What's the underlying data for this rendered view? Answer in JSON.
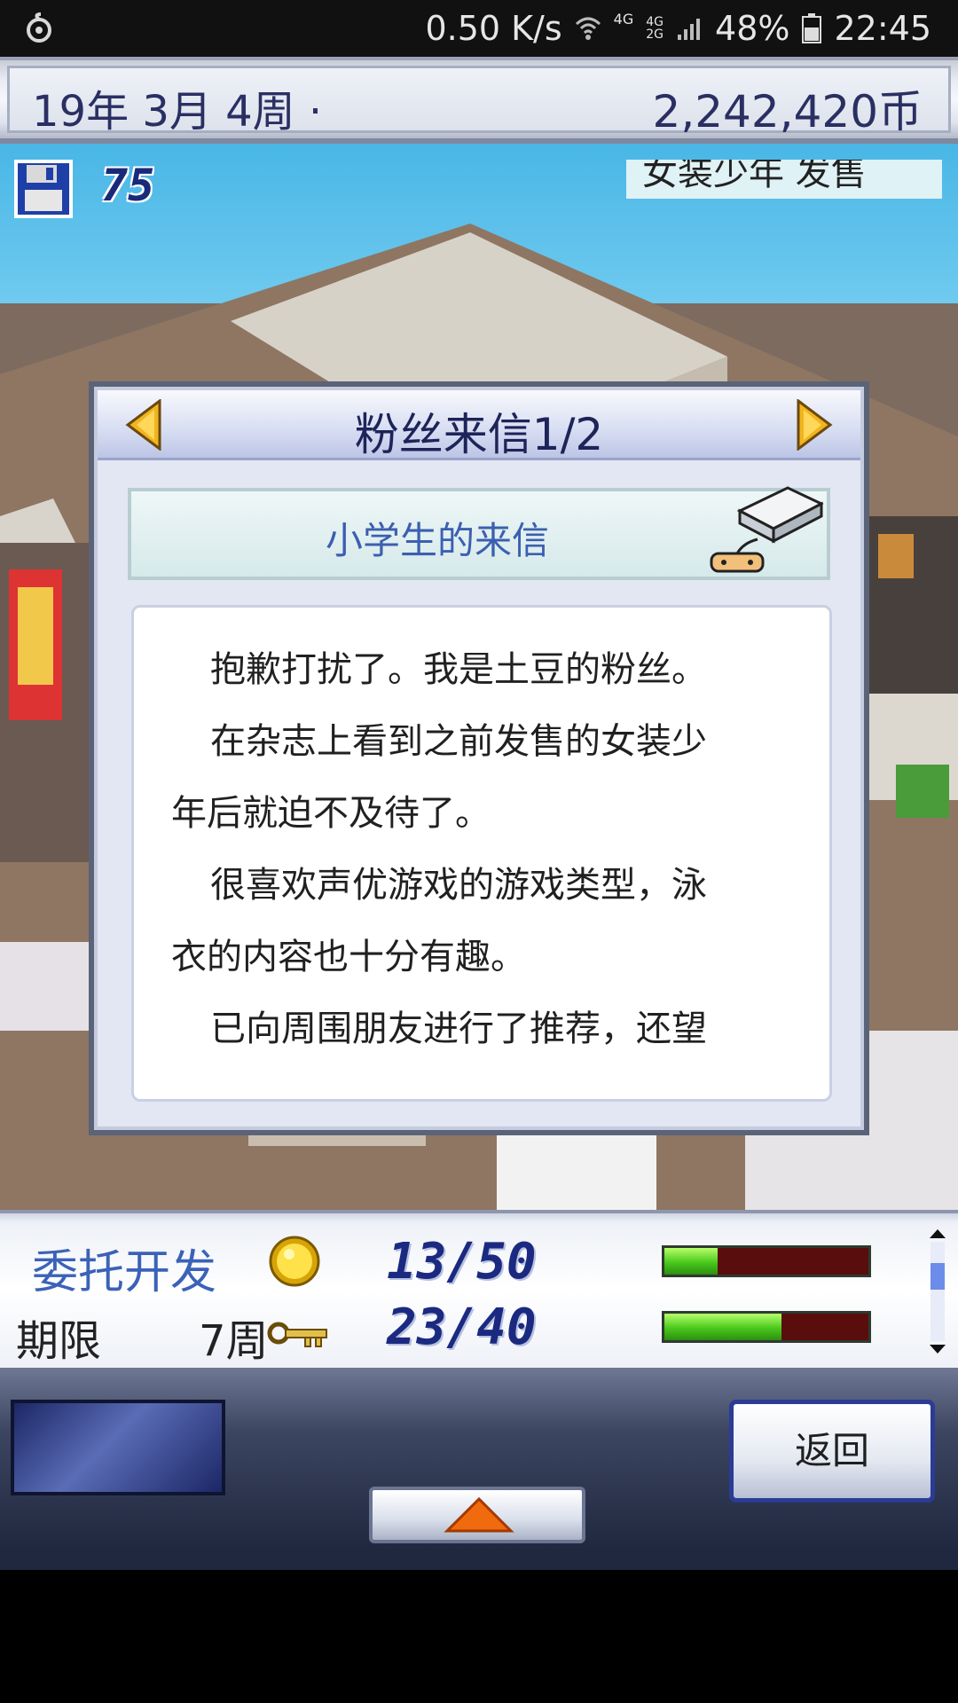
{
  "status_bar": {
    "net_speed": "0.50 K/s",
    "network_4g_top": "4G",
    "network_4g_mid": "4G",
    "network_2g": "2G",
    "battery": "48%",
    "time": "22:45"
  },
  "top_bar": {
    "date": "19年 3月 4周 ·",
    "money": "2,242,420币"
  },
  "scene": {
    "save_count": "75",
    "ticker_text": "女装少年 发售"
  },
  "dialog": {
    "title": "粉丝来信1/2",
    "sender": "小学生的来信",
    "paragraphs": [
      "抱歉打扰了。我是土豆的粉丝。",
      "在杂志上看到之前发售的女装少",
      "年后就迫不及待了。",
      "很喜欢声优游戏的游戏类型，泳",
      "衣的内容也十分有趣。",
      "已向周围朋友进行了推荐，还望"
    ]
  },
  "commission": {
    "label": "委托开发",
    "deadline_label": "期限",
    "deadline_value": "7周",
    "progress_1": "13/50",
    "progress_1_fraction": 0.26,
    "progress_2": "23/40",
    "progress_2_fraction": 0.575
  },
  "bottom": {
    "back_label": "返回"
  },
  "colors": {
    "accent_blue": "#3b62b8",
    "title_navy": "#1d2459",
    "bar_green": "#49c81c",
    "bar_bg": "#5a0d0d"
  }
}
